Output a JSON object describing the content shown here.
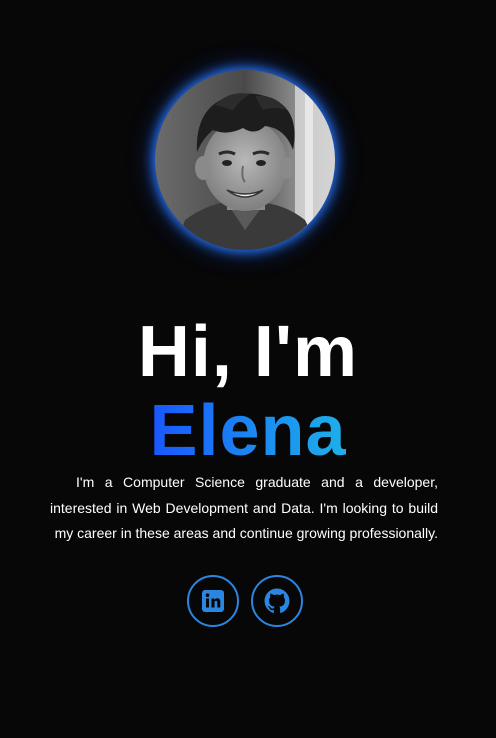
{
  "hero": {
    "greeting": "Hi, I'm",
    "name": "Elena",
    "bio": "I'm a Computer Science graduate and a developer, interested in Web Development and Data. I'm looking to build my career in these areas and continue growing professionally.",
    "avatar_alt": "Portrait photo of Elena"
  },
  "socials": [
    {
      "icon": "linkedin-icon",
      "label": "LinkedIn"
    },
    {
      "icon": "github-icon",
      "label": "GitHub"
    }
  ],
  "colors": {
    "background": "#070708",
    "accent": "#1a6cff",
    "accent_secondary": "#1fb0e8",
    "icon_blue": "#2a86e0",
    "text": "#ffffff"
  }
}
